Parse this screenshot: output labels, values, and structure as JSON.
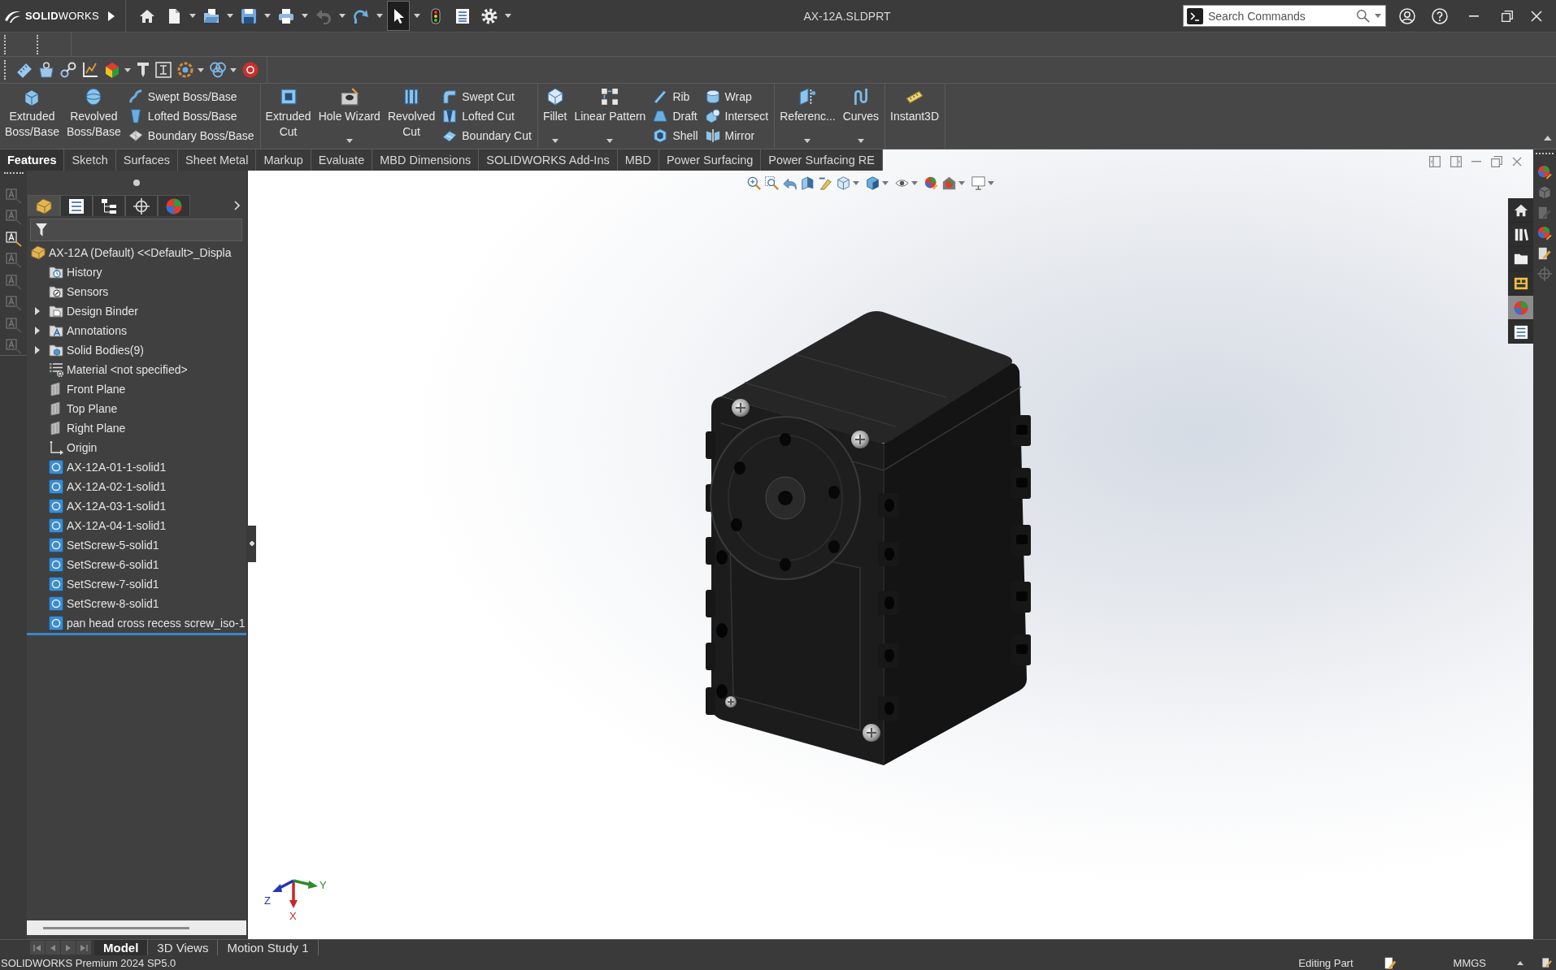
{
  "window": {
    "logo": "**SOLID**WORKS",
    "title": "AX-12A.SLDPRT"
  },
  "quick_access": [
    {
      "kind": "home",
      "dropdown": false,
      "disabled": false,
      "pressed": false
    },
    {
      "kind": "new",
      "dropdown": true,
      "disabled": false,
      "pressed": false
    },
    {
      "kind": "open",
      "dropdown": true,
      "disabled": false,
      "pressed": false
    },
    {
      "kind": "save",
      "dropdown": true,
      "disabled": false,
      "pressed": false
    },
    {
      "kind": "print",
      "dropdown": true,
      "disabled": false,
      "pressed": false
    },
    {
      "kind": "undo",
      "dropdown": true,
      "disabled": true,
      "pressed": false
    },
    {
      "kind": "redo",
      "dropdown": true,
      "disabled": false,
      "pressed": false
    },
    {
      "kind": "select",
      "dropdown": true,
      "disabled": false,
      "pressed": true
    },
    {
      "kind": "rebuild",
      "dropdown": false,
      "disabled": false,
      "pressed": false
    },
    {
      "kind": "file_properties",
      "dropdown": false,
      "disabled": false,
      "pressed": false
    },
    {
      "kind": "options",
      "dropdown": true,
      "disabled": false,
      "pressed": false
    }
  ],
  "search": {
    "placeholder": "Search Commands"
  },
  "toolbar": [
    {
      "kind": "measure",
      "dropdown": false
    },
    {
      "kind": "mass",
      "dropdown": false
    },
    {
      "kind": "mates",
      "dropdown": false
    },
    {
      "kind": "axes",
      "dropdown": false
    },
    {
      "kind": "color",
      "dropdown": true
    },
    {
      "kind": "pin",
      "dropdown": false
    },
    {
      "kind": "dimension",
      "dropdown": false
    },
    {
      "kind": "ring",
      "dropdown": true
    },
    {
      "kind": "knot",
      "dropdown": true
    },
    {
      "kind": "badge",
      "dropdown": false
    }
  ],
  "ribbon": {
    "groups": [
      {
        "columns": [
          {
            "kind": "large",
            "label": "Extruded Boss/Base",
            "dropdown": false
          },
          {
            "kind": "large",
            "label": "Revolved Boss/Base",
            "dropdown": false
          },
          {
            "kind": "stack",
            "items": [
              {
                "label": "Swept Boss/Base"
              },
              {
                "label": "Lofted Boss/Base"
              },
              {
                "label": "Boundary Boss/Base"
              }
            ]
          }
        ]
      },
      {
        "columns": [
          {
            "kind": "large",
            "label": "Extruded Cut",
            "dropdown": false
          },
          {
            "kind": "large",
            "label": "Hole Wizard",
            "dropdown": true
          },
          {
            "kind": "large",
            "label": "Revolved Cut",
            "dropdown": false
          },
          {
            "kind": "stack",
            "items": [
              {
                "label": "Swept Cut"
              },
              {
                "label": "Lofted Cut"
              },
              {
                "label": "Boundary Cut"
              }
            ]
          }
        ]
      },
      {
        "columns": [
          {
            "kind": "large",
            "label": "Fillet",
            "dropdown": true
          },
          {
            "kind": "large",
            "label": "Linear Pattern",
            "dropdown": true
          },
          {
            "kind": "stack",
            "items": [
              {
                "label": "Rib"
              },
              {
                "label": "Draft"
              },
              {
                "label": "Shell"
              }
            ]
          },
          {
            "kind": "stack",
            "items": [
              {
                "label": "Wrap"
              },
              {
                "label": "Intersect"
              },
              {
                "label": "Mirror"
              }
            ]
          }
        ]
      },
      {
        "columns": [
          {
            "kind": "large",
            "label": "Referenc...",
            "dropdown": true
          },
          {
            "kind": "large",
            "label": "Curves",
            "dropdown": true
          }
        ]
      },
      {
        "columns": [
          {
            "kind": "large",
            "label": "Instant3D",
            "dropdown": false
          }
        ]
      }
    ]
  },
  "command_tabs": [
    {
      "label": "Features",
      "selected": true
    },
    {
      "label": "Sketch",
      "selected": false
    },
    {
      "label": "Surfaces",
      "selected": false
    },
    {
      "label": "Sheet Metal",
      "selected": false
    },
    {
      "label": "Markup",
      "selected": false
    },
    {
      "label": "Evaluate",
      "selected": false
    },
    {
      "label": "MBD Dimensions",
      "selected": false
    },
    {
      "label": "SOLIDWORKS Add-Ins",
      "selected": false
    },
    {
      "label": "MBD",
      "selected": false
    },
    {
      "label": "Power Surfacing",
      "selected": false
    },
    {
      "label": "Power Surfacing RE",
      "selected": false
    }
  ],
  "side_tools": [
    {
      "disabled": true
    },
    {
      "disabled": true
    },
    {
      "disabled": false
    },
    {
      "disabled": true
    },
    {
      "disabled": true
    },
    {
      "disabled": true
    },
    {
      "disabled": true
    },
    {
      "disabled": true
    }
  ],
  "manager_tabs": [
    {
      "kind": "feature_manager",
      "selected": true
    },
    {
      "kind": "property_manager",
      "selected": false
    },
    {
      "kind": "configuration_manager",
      "selected": false
    },
    {
      "kind": "dimxpert",
      "selected": false
    },
    {
      "kind": "display_manager",
      "selected": false
    }
  ],
  "feature_tree": {
    "root": {
      "label": "AX-12A (Default) <<Default>_Displa",
      "children": [
        {
          "kind": "history",
          "label": "History",
          "expandable": false
        },
        {
          "kind": "sensors",
          "label": "Sensors",
          "expandable": false
        },
        {
          "kind": "design_binder",
          "label": "Design Binder",
          "expandable": true
        },
        {
          "kind": "annotations",
          "label": "Annotations",
          "expandable": true
        },
        {
          "kind": "solid_bodies",
          "label": "Solid Bodies(9)",
          "expandable": true
        },
        {
          "kind": "material",
          "label": "Material <not specified>",
          "expandable": false
        },
        {
          "kind": "plane",
          "label": "Front Plane",
          "expandable": false
        },
        {
          "kind": "plane",
          "label": "Top Plane",
          "expandable": false
        },
        {
          "kind": "plane",
          "label": "Right Plane",
          "expandable": false
        },
        {
          "kind": "origin",
          "label": "Origin",
          "expandable": false
        },
        {
          "kind": "body",
          "label": "AX-12A-01-1-solid1",
          "expandable": false
        },
        {
          "kind": "body",
          "label": "AX-12A-02-1-solid1",
          "expandable": false
        },
        {
          "kind": "body",
          "label": "AX-12A-03-1-solid1",
          "expandable": false
        },
        {
          "kind": "body",
          "label": "AX-12A-04-1-solid1",
          "expandable": false
        },
        {
          "kind": "body",
          "label": "SetScrew-5-solid1",
          "expandable": false
        },
        {
          "kind": "body",
          "label": "SetScrew-6-solid1",
          "expandable": false
        },
        {
          "kind": "body",
          "label": "SetScrew-7-solid1",
          "expandable": false
        },
        {
          "kind": "body",
          "label": "SetScrew-8-solid1",
          "expandable": false
        },
        {
          "kind": "body",
          "label": "pan head cross recess screw_iso-1",
          "expandable": false
        }
      ]
    }
  },
  "view_toolbar": [
    {
      "kind": "zoom_fit",
      "dropdown": false
    },
    {
      "kind": "zoom_area",
      "dropdown": false
    },
    {
      "kind": "previous_view",
      "dropdown": false
    },
    {
      "kind": "section_view",
      "dropdown": false
    },
    {
      "kind": "dynamic_annotation",
      "dropdown": false
    },
    {
      "kind": "view_orientation",
      "dropdown": true
    },
    {
      "kind": "display_style",
      "dropdown": true
    },
    {
      "kind": "hide_show",
      "dropdown": true
    },
    {
      "kind": "edit_appearance",
      "dropdown": false
    },
    {
      "kind": "apply_scene",
      "dropdown": true
    },
    {
      "kind": "view_settings",
      "dropdown": true
    }
  ],
  "task_pane_tabs": [
    {
      "kind": "home",
      "selected": false
    },
    {
      "kind": "library",
      "selected": false
    },
    {
      "kind": "explorer",
      "selected": false
    },
    {
      "kind": "view_palette",
      "selected": false
    },
    {
      "kind": "appearances",
      "selected": true
    },
    {
      "kind": "properties",
      "selected": false
    }
  ],
  "tool_strip": [
    {
      "disabled": false
    },
    {
      "disabled": true
    },
    {
      "disabled": true
    },
    {
      "disabled": false
    },
    {
      "disabled": false
    },
    {
      "disabled": true
    }
  ],
  "triad": {
    "x": "X",
    "y": "Y",
    "z": "Z"
  },
  "bottom_tabs": [
    {
      "label": "Model",
      "selected": true
    },
    {
      "label": "3D Views",
      "selected": false
    },
    {
      "label": "Motion Study 1",
      "selected": false
    }
  ],
  "status_bar": {
    "product": "SOLIDWORKS Premium 2024 SP5.0",
    "mode": "Editing Part",
    "units": "MMGS"
  }
}
